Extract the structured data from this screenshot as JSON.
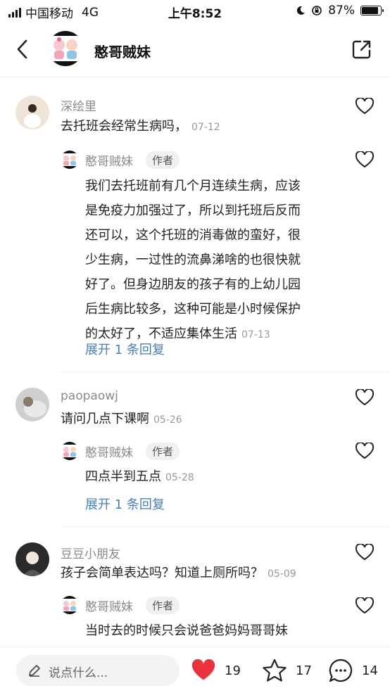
{
  "status_bar": {
    "carrier": "中国移动",
    "network": "4G",
    "time": "上午8:52",
    "battery": "87%",
    "battery_level": 0.87
  },
  "header": {
    "title": "憨哥贼妹"
  },
  "comments": [
    {
      "user": "深绘里",
      "text": "去托班会经常生病吗，",
      "date": "07-12",
      "reply": {
        "user": "憨哥贼妹",
        "tag": "作者",
        "lines": [
          "我们去托班前有几个月连续生病，应该",
          "是免疫力加强过了，所以到托班后反而",
          "还可以，这个托班的消毒做的蛮好，很",
          "少生病，一过性的流鼻涕啥的也很快就",
          "好了。但身边朋友的孩子有的上幼儿园",
          "后生病比较多，这种可能是小时候保护",
          "的太好了，不适应集体生活"
        ],
        "date": "07-13",
        "expand": "展开 1 条回复"
      }
    },
    {
      "user": "paopaowj",
      "text": "请问几点下课啊",
      "date": "05-26",
      "reply": {
        "user": "憨哥贼妹",
        "tag": "作者",
        "lines": [
          "四点半到五点"
        ],
        "date": "05-28",
        "expand": "展开 1 条回复"
      }
    },
    {
      "user": "豆豆小朋友",
      "text": "孩子会简单表达吗？知道上厕所吗？",
      "date": "05-09",
      "reply": {
        "user": "憨哥贼妹",
        "tag": "作者",
        "lines": [
          "当时去的时候只会说爸爸妈妈哥哥妹"
        ]
      }
    }
  ],
  "bottom_bar": {
    "input_placeholder": "说点什么...",
    "likes": "19",
    "stars": "17",
    "comments": "14",
    "like_color": "#e8323c"
  }
}
